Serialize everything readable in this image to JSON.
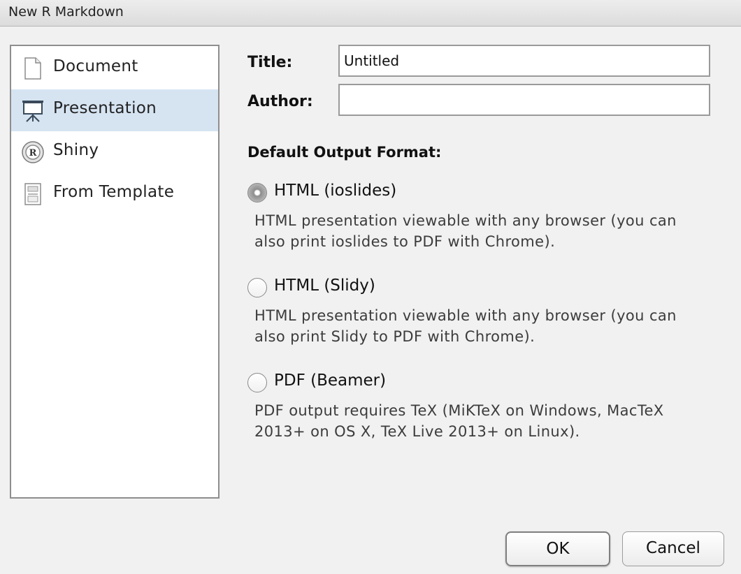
{
  "window": {
    "title": "New R Markdown"
  },
  "sidebar": {
    "items": [
      {
        "label": "Document",
        "icon": "document-icon",
        "selected": false
      },
      {
        "label": "Presentation",
        "icon": "presentation-icon",
        "selected": true
      },
      {
        "label": "Shiny",
        "icon": "shiny-icon",
        "selected": false
      },
      {
        "label": "From Template",
        "icon": "template-icon",
        "selected": false
      }
    ]
  },
  "form": {
    "title_label": "Title:",
    "title_value": "Untitled",
    "author_label": "Author:",
    "author_value": ""
  },
  "output_format": {
    "heading": "Default Output Format:",
    "options": [
      {
        "label": "HTML (ioslides)",
        "checked": true,
        "description_line1": "HTML presentation viewable with any browser (you can",
        "description_line2": "also print ioslides to PDF with Chrome)."
      },
      {
        "label": "HTML (Slidy)",
        "checked": false,
        "description_line1": "HTML presentation viewable with any browser (you can",
        "description_line2": "also print Slidy to PDF with Chrome)."
      },
      {
        "label": "PDF (Beamer)",
        "checked": false,
        "description_line1": "PDF output requires TeX (MiKTeX on Windows, MacTeX",
        "description_line2": "2013+ on OS X, TeX Live 2013+ on Linux)."
      }
    ]
  },
  "buttons": {
    "ok_label": "OK",
    "cancel_label": "Cancel"
  },
  "colors": {
    "selection": "#d6e4f2",
    "background": "#f0f1f0"
  }
}
